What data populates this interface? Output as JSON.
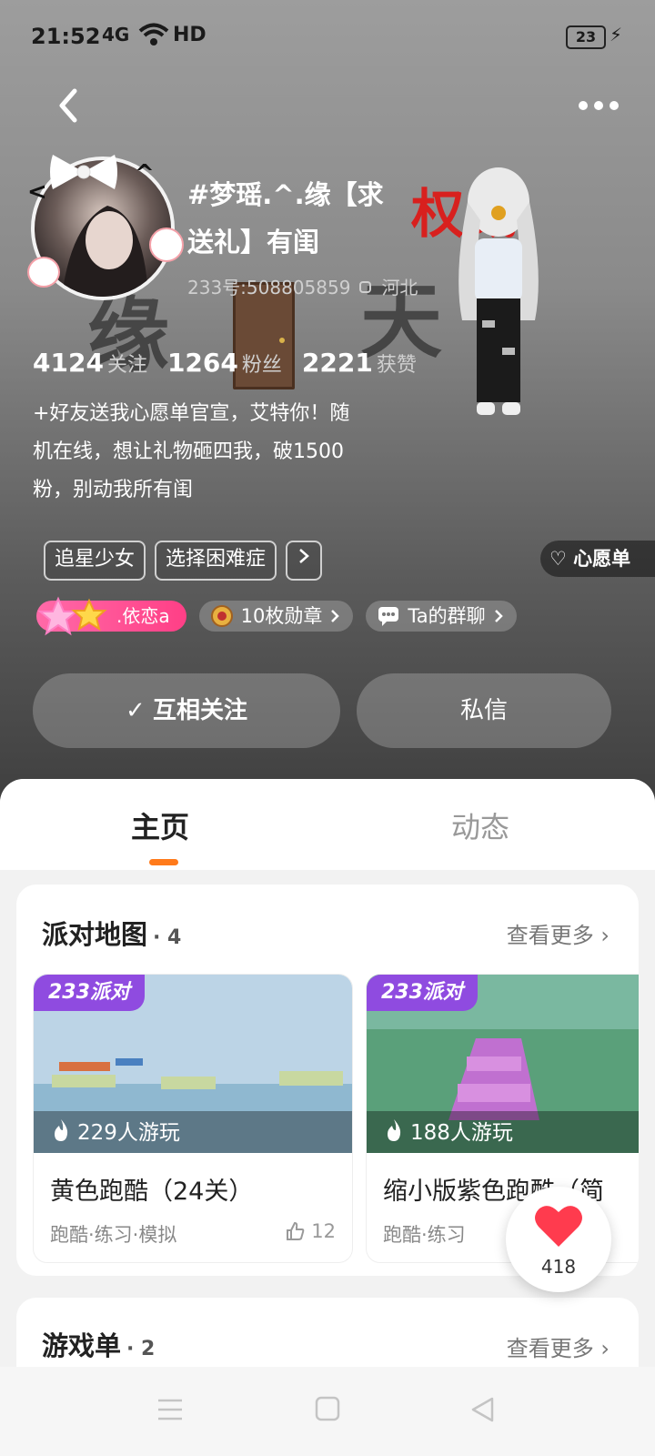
{
  "status": {
    "time": "21:52",
    "signal": "4G",
    "network_label": "HD",
    "battery": "23"
  },
  "profile": {
    "username": "#梦瑶.^.缘【求送礼】有闺",
    "uid": "233号:508805859",
    "location": "河北",
    "stats": [
      {
        "value": "4124",
        "label": "关注"
      },
      {
        "value": "1264",
        "label": "粉丝"
      },
      {
        "value": "2221",
        "label": "获赞"
      }
    ],
    "bio": "+好友送我心愿单官宣，艾特你！随机在线，想让礼物砸四我，破1500粉，别动我所有闺",
    "tags": [
      "追星少女",
      "选择困难症"
    ],
    "wishlist_label": "心愿单",
    "name_chip": ".依恋a",
    "badges_chip": "10枚勋章",
    "group_chip": "Ta的群聊",
    "follow_button": "互相关注",
    "message_button": "私信"
  },
  "tabs": [
    {
      "label": "主页"
    },
    {
      "label": "动态"
    }
  ],
  "party_maps": {
    "title": "派对地图",
    "count": "· 4",
    "see_more": "查看更多",
    "games": [
      {
        "badge": "233派对",
        "plays": "229人游玩",
        "name": "黄色跑酷（24关）",
        "tags": "跑酷·练习·模拟",
        "likes": "12"
      },
      {
        "badge": "233派对",
        "plays": "188人游玩",
        "name": "缩小版紫色跑酷（简",
        "tags": "跑酷·练习",
        "likes": ""
      }
    ]
  },
  "game_list": {
    "title": "游戏单",
    "count": "· 2",
    "see_more": "查看更多"
  },
  "heart_fab": {
    "count": "418"
  },
  "colors": {
    "accent": "#ff7a1a",
    "badge_purple": "#8f4be0",
    "pink_chip": "#ff4a8d"
  }
}
